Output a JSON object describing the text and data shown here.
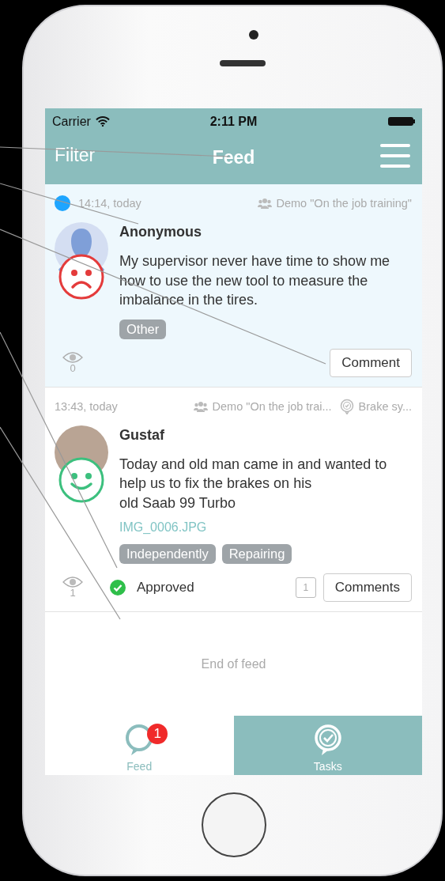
{
  "status_bar": {
    "carrier": "Carrier",
    "time": "2:11 PM"
  },
  "nav_bar": {
    "left": "Filter",
    "title": "Feed"
  },
  "posts": [
    {
      "unread": true,
      "time": "14:14, today",
      "group": "Demo \"On the job training\"",
      "author": "Anonymous",
      "avatar": {
        "kind": "silhouette"
      },
      "mood": {
        "kind": "sad"
      },
      "text": "My supervisor never have time to show me how to use the new tool to measure the imbalance in the tires.",
      "tags": [
        "Other"
      ],
      "views": "0",
      "action": "Comment",
      "highlighted": true
    },
    {
      "unread": false,
      "time": "13:43, today",
      "group": "Demo \"On the job trai...",
      "topic": "Brake sy...",
      "author": "Gustaf",
      "avatar": {
        "kind": "photo"
      },
      "mood": {
        "kind": "happy"
      },
      "text": "Today and old man came in and wanted to help us to fix the brakes on his\nold Saab 99 Turbo",
      "attachment": "IMG_0006.JPG",
      "tags": [
        "Independently",
        "Repairing"
      ],
      "views": "1",
      "status": "Approved",
      "comment_count": "1",
      "action": "Comments",
      "highlighted": false
    }
  ],
  "end_text": "End of feed",
  "tabs": [
    {
      "label": "Feed",
      "kind": "feed",
      "badge": "1",
      "selected": true
    },
    {
      "label": "Tasks",
      "kind": "tasks",
      "selected": false
    }
  ]
}
